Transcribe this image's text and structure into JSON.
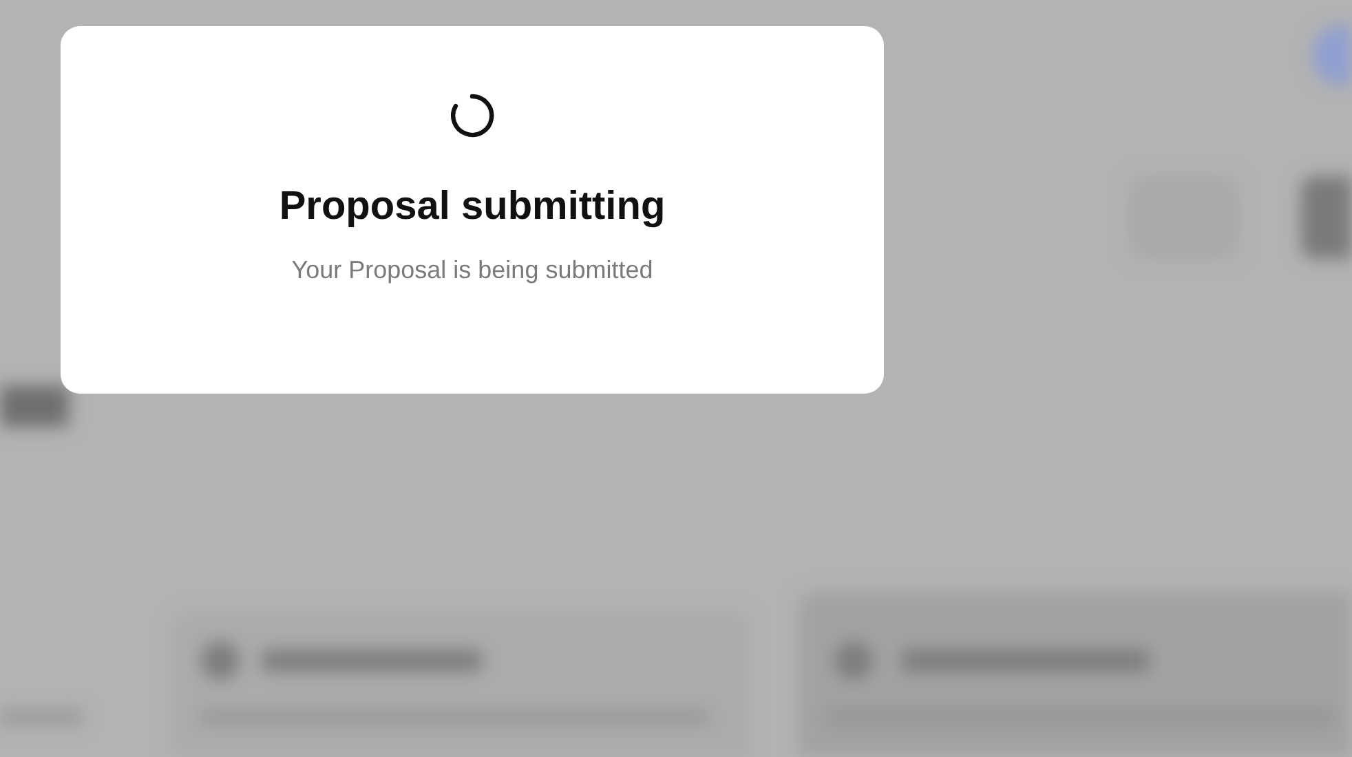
{
  "dialog": {
    "loading": true,
    "title": "Proposal submitting",
    "message": "Your Proposal is being submitted"
  }
}
